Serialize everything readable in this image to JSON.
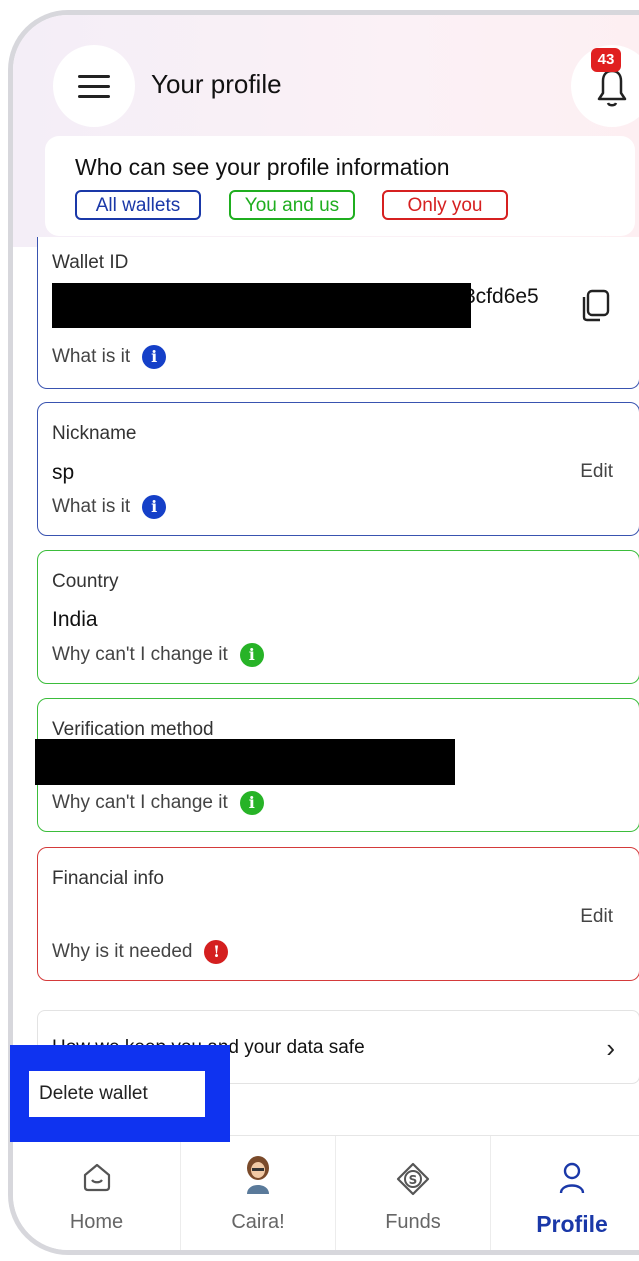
{
  "header": {
    "title": "Your profile",
    "notification_count": "43"
  },
  "visibility": {
    "title": "Who can see your profile information",
    "all_wallets": "All wallets",
    "you_and_us": "You and us",
    "only_you": "Only you"
  },
  "wallet_id": {
    "label": "Wallet ID",
    "value_visible": "3cfd6e5",
    "help": "What is it"
  },
  "nickname": {
    "label": "Nickname",
    "value": "sp",
    "edit": "Edit",
    "help": "What is it"
  },
  "country": {
    "label": "Country",
    "value": "India",
    "help": "Why can't I change it"
  },
  "verification": {
    "label": "Verification method",
    "help": "Why can't I change it"
  },
  "financial": {
    "label": "Financial info",
    "edit": "Edit",
    "help": "Why is it needed"
  },
  "safety_link": "How we keep you and your data safe",
  "delete_wallet": "Delete wallet",
  "tabs": [
    {
      "label": "Home",
      "icon": "home-icon"
    },
    {
      "label": "Caira!",
      "icon": "avatar-icon"
    },
    {
      "label": "Funds",
      "icon": "funds-icon"
    },
    {
      "label": "Profile",
      "icon": "profile-icon"
    }
  ],
  "colors": {
    "private_blue": "#1a38a8",
    "shared_green": "#1fae1f",
    "only_you_red": "#d62020",
    "highlight": "#0f33f0"
  }
}
